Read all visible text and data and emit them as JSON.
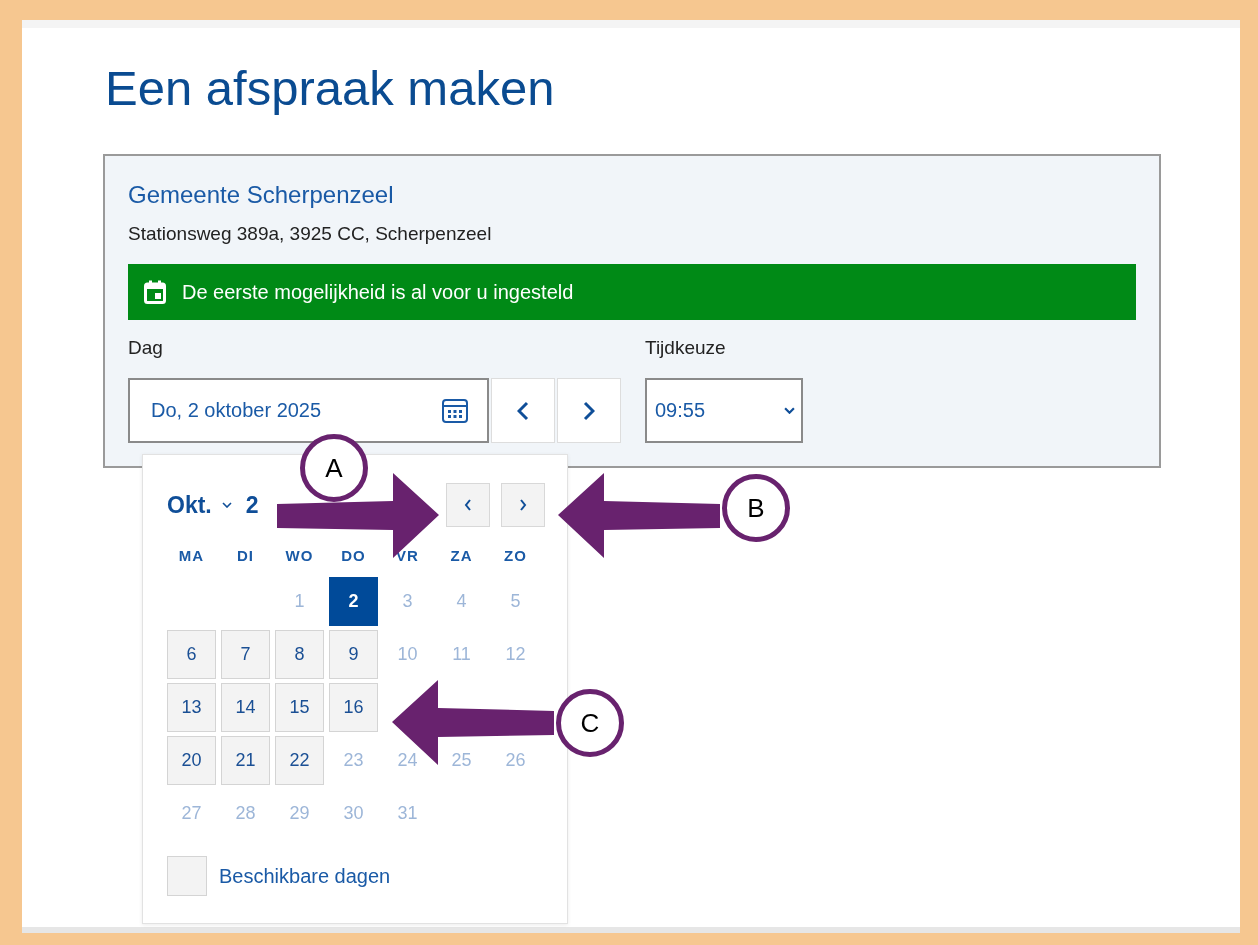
{
  "page_title": "Een afspraak maken",
  "location": {
    "name": "Gemeente Scherpenzeel",
    "address": "Stationsweg 389a, 3925 CC, Scherpenzeel"
  },
  "notice": {
    "text": "De eerste mogelijkheid is al voor u ingesteld"
  },
  "day_field": {
    "label": "Dag",
    "value": "Do, 2 oktober 2025"
  },
  "time_field": {
    "label": "Tijdkeuze",
    "value": "09:55"
  },
  "calendar": {
    "month": "Okt.",
    "year": "2",
    "weekdays": [
      "MA",
      "DI",
      "WO",
      "DO",
      "VR",
      "ZA",
      "ZO"
    ],
    "weeks": [
      [
        {
          "day": "1",
          "available": false,
          "selected": false
        },
        {
          "day": "2",
          "available": true,
          "selected": true
        },
        {
          "day": "3",
          "available": false,
          "selected": false
        },
        {
          "day": "4",
          "available": false,
          "selected": false
        },
        {
          "day": "5",
          "available": false,
          "selected": false
        }
      ],
      [
        {
          "day": "6",
          "available": true,
          "selected": false
        },
        {
          "day": "7",
          "available": true,
          "selected": false
        },
        {
          "day": "8",
          "available": true,
          "selected": false
        },
        {
          "day": "9",
          "available": true,
          "selected": false
        },
        {
          "day": "10",
          "available": false,
          "selected": false
        },
        {
          "day": "11",
          "available": false,
          "selected": false
        },
        {
          "day": "12",
          "available": false,
          "selected": false
        }
      ],
      [
        {
          "day": "13",
          "available": true,
          "selected": false
        },
        {
          "day": "14",
          "available": true,
          "selected": false
        },
        {
          "day": "15",
          "available": true,
          "selected": false
        },
        {
          "day": "16",
          "available": true,
          "selected": false
        }
      ],
      [
        {
          "day": "20",
          "available": true,
          "selected": false
        },
        {
          "day": "21",
          "available": true,
          "selected": false
        },
        {
          "day": "22",
          "available": true,
          "selected": false
        },
        {
          "day": "23",
          "available": false,
          "selected": false
        },
        {
          "day": "24",
          "available": false,
          "selected": false
        },
        {
          "day": "25",
          "available": false,
          "selected": false
        },
        {
          "day": "26",
          "available": false,
          "selected": false
        }
      ],
      [
        {
          "day": "27",
          "available": false,
          "selected": false
        },
        {
          "day": "28",
          "available": false,
          "selected": false
        },
        {
          "day": "29",
          "available": false,
          "selected": false
        },
        {
          "day": "30",
          "available": false,
          "selected": false
        },
        {
          "day": "31",
          "available": false,
          "selected": false
        }
      ]
    ],
    "legend": "Beschikbare dagen"
  },
  "callouts": [
    {
      "label": "A"
    },
    {
      "label": "B"
    },
    {
      "label": "C"
    }
  ]
}
